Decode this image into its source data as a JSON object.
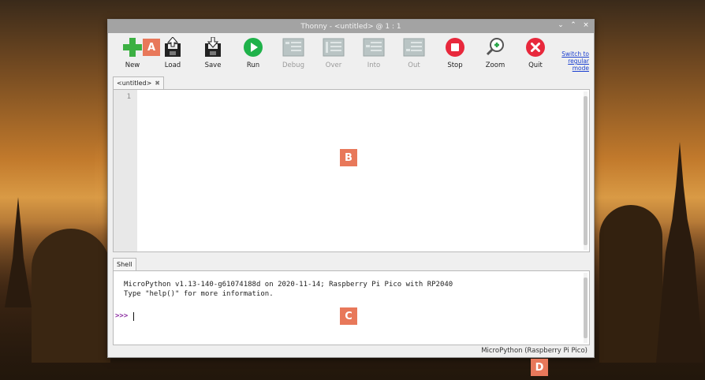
{
  "window": {
    "title": "Thonny  -  <untitled>  @  1 : 1",
    "controls": [
      "⌄",
      "⌃",
      "×"
    ]
  },
  "toolbar": {
    "buttons": [
      {
        "label": "New",
        "icon": "new-file-plus-icon",
        "enabled": true
      },
      {
        "label": "Load",
        "icon": "load-floppy-icon",
        "enabled": true
      },
      {
        "label": "Save",
        "icon": "save-floppy-icon",
        "enabled": true
      },
      {
        "label": "Run",
        "icon": "run-play-icon",
        "enabled": true
      },
      {
        "label": "Debug",
        "icon": "debug-icon",
        "enabled": false
      },
      {
        "label": "Over",
        "icon": "step-over-icon",
        "enabled": false
      },
      {
        "label": "Into",
        "icon": "step-into-icon",
        "enabled": false
      },
      {
        "label": "Out",
        "icon": "step-out-icon",
        "enabled": false
      },
      {
        "label": "Stop",
        "icon": "stop-icon",
        "enabled": true
      },
      {
        "label": "Zoom",
        "icon": "zoom-icon",
        "enabled": true
      },
      {
        "label": "Quit",
        "icon": "quit-icon",
        "enabled": true
      }
    ],
    "switch_mode_link": "Switch to regular mode"
  },
  "editor": {
    "tab_label": "<untitled>",
    "tab_close": "✖",
    "line_numbers": [
      "1"
    ]
  },
  "shell": {
    "tab_label": "Shell",
    "output_lines": [
      "MicroPython v1.13-140-g61074188d on 2020-11-14; Raspberry Pi Pico with RP2040",
      "Type \"help()\" for more information."
    ],
    "prompt": ">>>"
  },
  "status": {
    "interpreter": "MicroPython (Raspberry Pi Pico)"
  },
  "markers": [
    "A",
    "B",
    "C",
    "D"
  ],
  "colors": {
    "marker": "#e8785a",
    "run_green": "#1fb24a",
    "stop_red": "#e8283c",
    "link_blue": "#1a3fd0"
  }
}
